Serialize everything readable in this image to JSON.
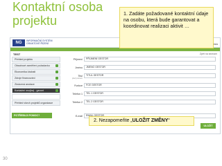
{
  "slide": {
    "title_line1": "Kontaktní osoba",
    "title_line2": "projektu",
    "page_number": "30"
  },
  "callout1": {
    "text": "1. Zadáte požadované kontaktní údaje na osobu, která bude garantovat a koordinovat realizaci aktivit …"
  },
  "callout2": {
    "prefix": "2. Nezapomeňte „",
    "bold": "ULOŽIT ZMĚNY",
    "suffix": "“"
  },
  "app": {
    "logo_box": "NG",
    "logo_line1": "INFORMAČNÍ SYSTÉM",
    "logo_line2": "GRANTOVÉ ŘÍZENÍ",
    "nav_links": [
      "Odhlásit",
      "Změna hesla"
    ],
    "breadcrumb": "TEST",
    "breadcrumb_right": "Zpět na seznam",
    "sidebar": [
      {
        "label": "Přehled projektu",
        "check": false
      },
      {
        "label": "Obsahové zaměření požadavku",
        "check": true
      },
      {
        "label": "Ekonomika žádosti",
        "check": true
      },
      {
        "label": "Zdroje financování",
        "check": true
      },
      {
        "label": "Zkrácená anotace",
        "check": true
      },
      {
        "label": "Kontaktní oso(ba) - garant",
        "check": true
      },
      {
        "label": "",
        "check": false
      },
      {
        "label": "Přehled všech projektů organizace",
        "check": false
      }
    ],
    "sidebar_button": "POTŘEBUJI POMOC?",
    "form": [
      {
        "label": "Příjmení",
        "value": "PŘIJMENÍ GESTOR",
        "sub": ""
      },
      {
        "label": "Jméno",
        "value": "JMENO GESTOR",
        "sub": ""
      },
      {
        "label": "Titul",
        "value": "TITUL GESTOR",
        "sub": "před jménem"
      },
      {
        "label": "Funkce",
        "value": "FCE GESTOR",
        "sub": ""
      },
      {
        "label": "Telefon 1",
        "value": "TEL 1 GESTOR",
        "sub": ""
      },
      {
        "label": "Telefon 2",
        "value": "TEL 2 GESTOR",
        "sub": ""
      },
      {
        "label": "E-mail",
        "value": "EMAIL GESTOR",
        "sub": ""
      }
    ],
    "save_button": "ULOŽIT"
  },
  "colors": {
    "accent_green": "#7cb342",
    "title_green": "#8ec13a",
    "callout_bg": "#fff9cc"
  }
}
